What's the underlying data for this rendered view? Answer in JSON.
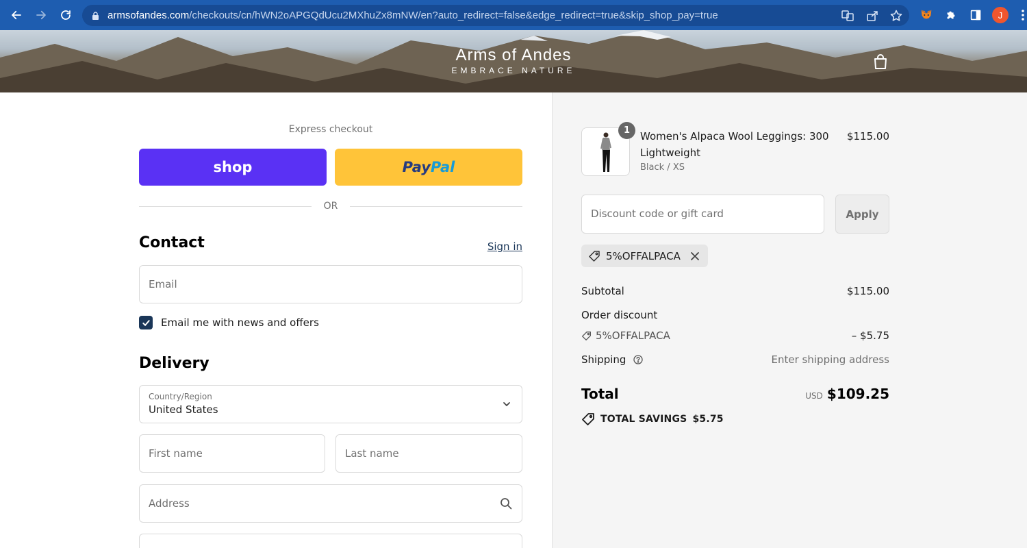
{
  "browser": {
    "url_host": "armsofandes.com",
    "url_path": "/checkouts/cn/hWN2oAPGQdUcu2MXhuZx8mNW/en?auto_redirect=false&edge_redirect=true&skip_shop_pay=true",
    "profile_initial": "J",
    "chrome_color": "#1e5db0"
  },
  "store": {
    "logo_title": "Arms of Andes",
    "logo_tagline": "EMBRACE NATURE"
  },
  "checkout": {
    "express_label": "Express checkout",
    "shop_label": "shop",
    "paypal_part1": "Pay",
    "paypal_part2": "Pal",
    "or_label": "OR",
    "contact_title": "Contact",
    "sign_in": "Sign in",
    "email_placeholder": "Email",
    "newsletter_label": "Email me with news and offers",
    "newsletter_checked": true,
    "delivery_title": "Delivery",
    "country_label": "Country/Region",
    "country_value": "United States",
    "first_name_placeholder": "First name",
    "last_name_placeholder": "Last name",
    "address_placeholder": "Address",
    "colors": {
      "shop": "#5a31f4",
      "paypal": "#ffc439",
      "accent": "#1a3658"
    }
  },
  "summary": {
    "item": {
      "quantity": "1",
      "name": "Women's Alpaca Wool Leggings: 300 Lightweight",
      "variant": "Black / XS",
      "price": "$115.00"
    },
    "discount_placeholder": "Discount code or gift card",
    "apply_label": "Apply",
    "applied_code": "5%OFFALPACA",
    "subtotal_label": "Subtotal",
    "subtotal_value": "$115.00",
    "order_discount_label": "Order discount",
    "order_discount_code": "5%OFFALPACA",
    "order_discount_value": "– $5.75",
    "shipping_label": "Shipping",
    "shipping_value": "Enter shipping address",
    "total_label": "Total",
    "total_currency": "USD",
    "total_value": "$109.25",
    "savings_label": "TOTAL SAVINGS",
    "savings_value": "$5.75"
  }
}
